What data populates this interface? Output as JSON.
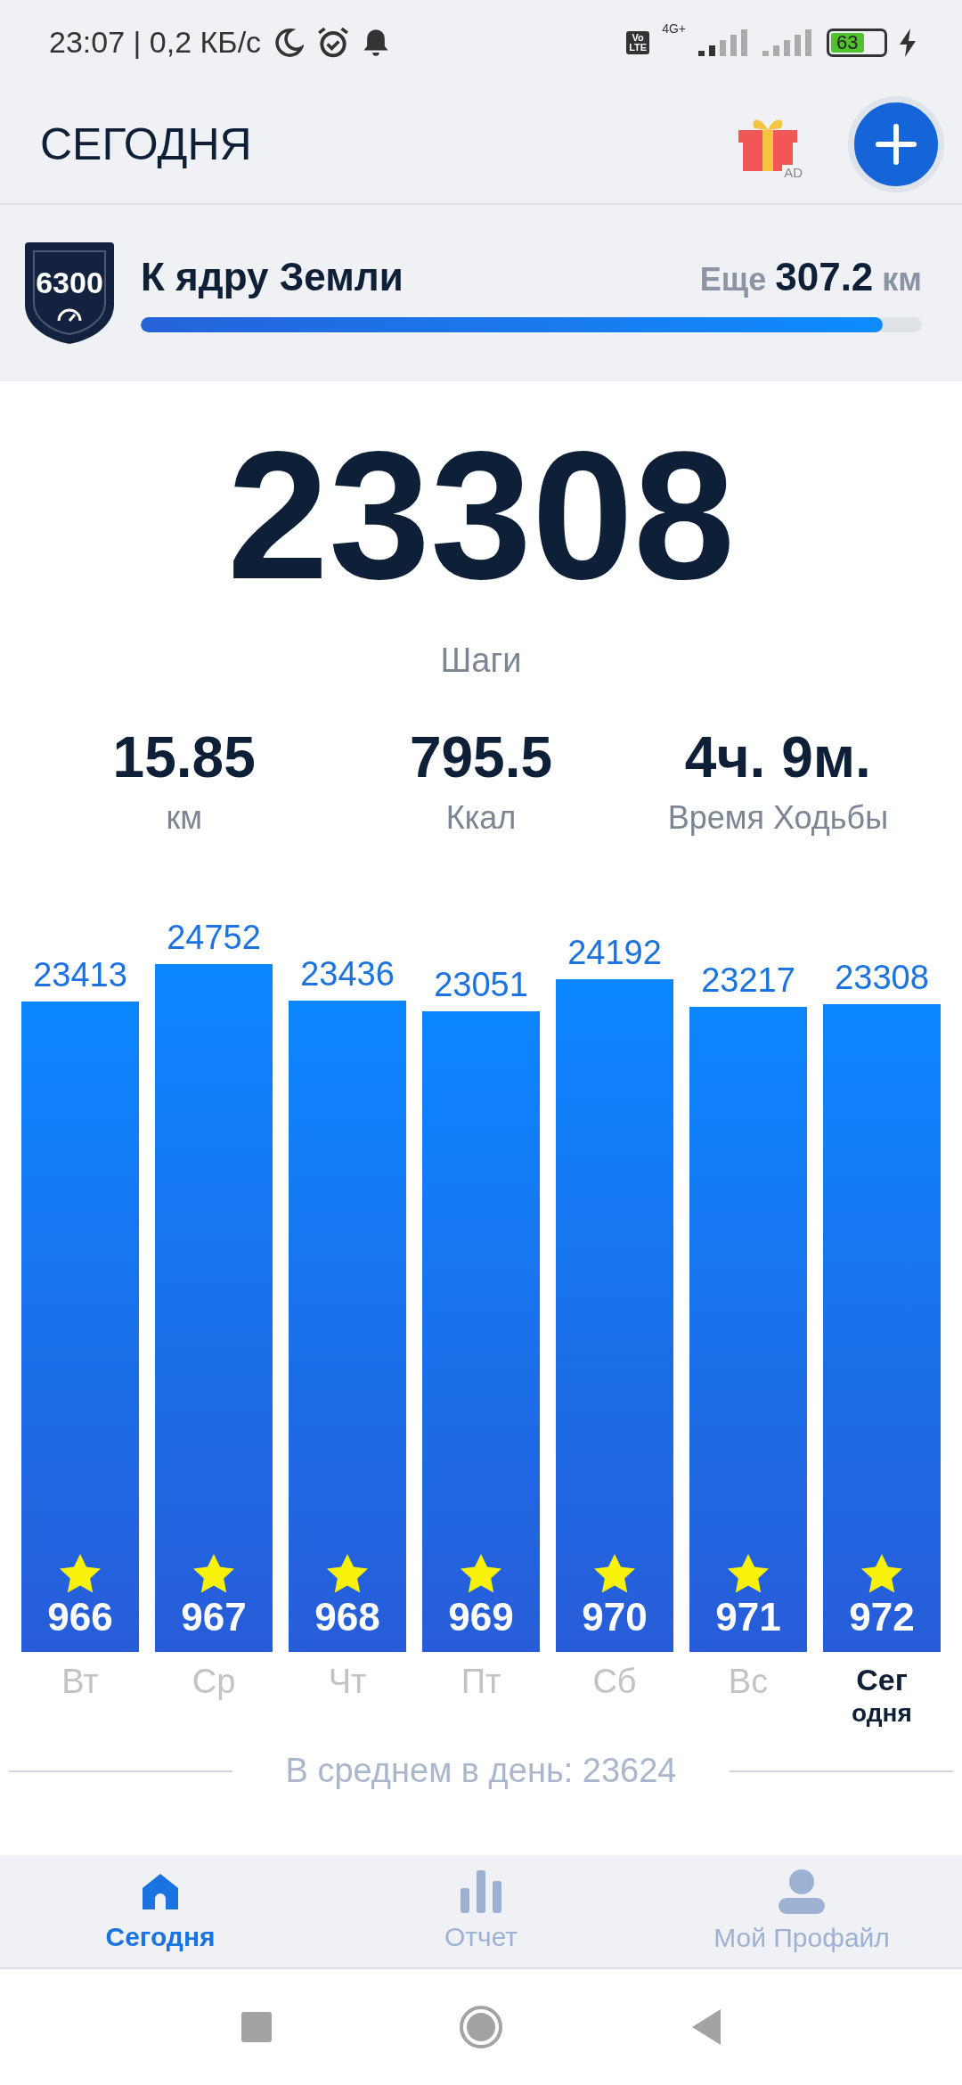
{
  "status_bar": {
    "time": "23:07 | 0,2 КБ/с",
    "volte": [
      "Vo",
      "LTE"
    ],
    "network": "4G+",
    "battery": "63"
  },
  "header": {
    "title": "СЕГОДНЯ",
    "gift_badge": "AD"
  },
  "goal": {
    "badge_number": "6300",
    "title": "К ядру Земли",
    "remaining_label": "Еще",
    "remaining_value": "307.2",
    "remaining_unit": "км",
    "level": 0.95
  },
  "steps": {
    "value": "23308",
    "label": "Шаги"
  },
  "stats": [
    {
      "value": "15.85",
      "label": "км"
    },
    {
      "value": "795.5",
      "label": "Ккал"
    },
    {
      "value": "4ч. 9м.",
      "label": "Время Ходьбы"
    }
  ],
  "chart": {
    "chart_data": {
      "type": "bar",
      "categories": [
        "Вт",
        "Ср",
        "Чт",
        "Пт",
        "Сб",
        "Вс",
        "Сегодня"
      ],
      "values": [
        23413,
        24752,
        23436,
        23051,
        24192,
        23217,
        23308
      ],
      "data_labels": true
    },
    "bar_badges": [
      {
        "number": "966",
        "selected": false
      },
      {
        "number": "967",
        "selected": false
      },
      {
        "number": "968",
        "selected": false
      },
      {
        "number": "969",
        "selected": false
      },
      {
        "number": "970",
        "selected": false
      },
      {
        "number": "971",
        "selected": false
      },
      {
        "number": "972",
        "selected": true
      }
    ]
  },
  "average": "В среднем в день: 23624",
  "tabs": [
    {
      "label": "Сегодня",
      "selected": true
    },
    {
      "label": "Отчет",
      "selected": false
    },
    {
      "label": "Мой Профайл",
      "selected": false
    }
  ]
}
